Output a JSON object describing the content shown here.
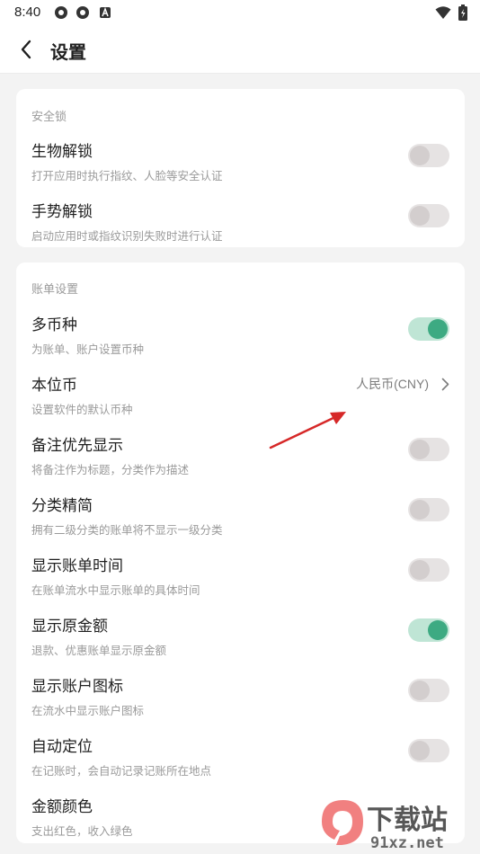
{
  "status": {
    "time": "8:40"
  },
  "header": {
    "title": "设置"
  },
  "sections": [
    {
      "title": "安全锁",
      "rows": [
        {
          "title": "生物解锁",
          "subtitle": "打开应用时执行指纹、人脸等安全认证",
          "toggle": false
        },
        {
          "title": "手势解锁",
          "subtitle": "启动应用时或指纹识别失败时进行认证",
          "toggle": false
        }
      ]
    },
    {
      "title": "账单设置",
      "rows": [
        {
          "title": "多币种",
          "subtitle": "为账单、账户设置币种",
          "toggle": true
        },
        {
          "title": "本位币",
          "subtitle": "设置软件的默认币种",
          "value": "人民币(CNY)"
        },
        {
          "title": "备注优先显示",
          "subtitle": "将备注作为标题，分类作为描述",
          "toggle": false
        },
        {
          "title": "分类精简",
          "subtitle": "拥有二级分类的账单将不显示一级分类",
          "toggle": false
        },
        {
          "title": "显示账单时间",
          "subtitle": "在账单流水中显示账单的具体时间",
          "toggle": false
        },
        {
          "title": "显示原金额",
          "subtitle": "退款、优惠账单显示原金额",
          "toggle": true
        },
        {
          "title": "显示账户图标",
          "subtitle": "在流水中显示账户图标",
          "toggle": false
        },
        {
          "title": "自动定位",
          "subtitle": "在记账时，会自动记录记账所在地点",
          "toggle": false
        },
        {
          "title": "金额颜色",
          "subtitle": "支出红色，收入绿色"
        }
      ]
    }
  ],
  "watermark": {
    "text": "下载站",
    "url": "91xz.net"
  },
  "colors": {
    "toggle_on": "#3daa82",
    "toggle_off": "#d3cece",
    "annotation_arrow": "#d62828"
  }
}
